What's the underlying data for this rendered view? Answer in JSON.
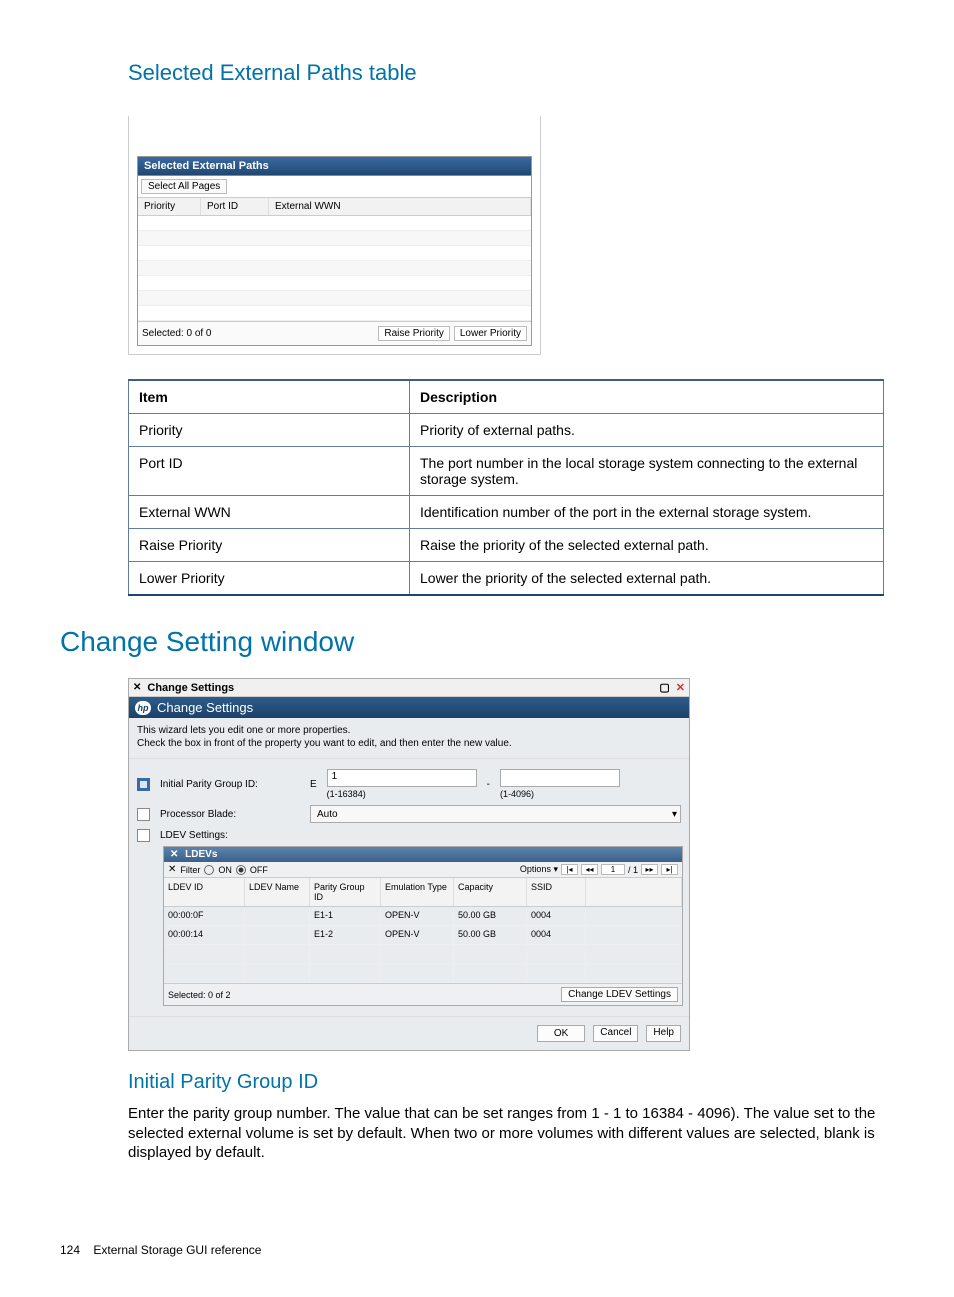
{
  "title1": "Selected External Paths table",
  "mock1": {
    "title": "Selected External Paths",
    "select_all": "Select All Pages",
    "headers": {
      "priority": "Priority",
      "port_id": "Port ID",
      "external_wwn": "External WWN"
    },
    "selected": "Selected: 0    of  0",
    "raise": "Raise Priority",
    "lower": "Lower Priority"
  },
  "desc_table": {
    "head": {
      "item": "Item",
      "description": "Description"
    },
    "rows": [
      {
        "item": "Priority",
        "description": "Priority of external paths."
      },
      {
        "item": "Port ID",
        "description": "The port number in the local storage system connecting to the external storage system."
      },
      {
        "item": "External WWN",
        "description": "Identification number of the port in the external storage system."
      },
      {
        "item": "Raise Priority",
        "description": "Raise the priority of the selected external path."
      },
      {
        "item": "Lower Priority",
        "description": "Lower the priority of the selected external path."
      }
    ]
  },
  "title2": "Change Setting window",
  "mock2": {
    "bar_title": "Change Settings",
    "panel_title": "Change Settings",
    "desc1": "This wizard lets you edit one or more properties.",
    "desc2": "Check the  box in front of the property you want to edit, and then enter the new value.",
    "ipg_label": "Initial Parity Group ID:",
    "ipg_prefix": "E",
    "ipg_v1": "1",
    "ipg_range1": "(1-16384)",
    "ipg_dash": "-",
    "ipg_range2": "(1-4096)",
    "pb_label": "Processor Blade:",
    "pb_value": "Auto",
    "ldev_label": "LDEV Settings:",
    "sec_title": "LDEVs",
    "filter_label": "Filter",
    "on": "ON",
    "off": "OFF",
    "options": "Options",
    "page_cur": "1",
    "page_total": "/ 1",
    "thead": {
      "c1": "LDEV ID",
      "c2": "LDEV Name",
      "c3": "Parity Group ID",
      "c4": "Emulation Type",
      "c5": "Capacity",
      "c6": "SSID"
    },
    "rows": [
      {
        "c1": "00:00:0F",
        "c2": "",
        "c3": "E1-1",
        "c4": "OPEN-V",
        "c5": "50.00 GB",
        "c6": "0004"
      },
      {
        "c1": "00:00:14",
        "c2": "",
        "c3": "E1-2",
        "c4": "OPEN-V",
        "c5": "50.00 GB",
        "c6": "0004"
      }
    ],
    "sec_selected": "Selected:  0     of  2",
    "change_btn": "Change LDEV Settings",
    "ok": "OK",
    "cancel": "Cancel",
    "help": "Help"
  },
  "title3": "Initial Parity Group ID",
  "para3": "Enter the parity group number. The value that can be set ranges from 1 - 1 to 16384 - 4096). The value set to the selected external volume is set by default. When two or more volumes with different values are selected, blank is displayed by default.",
  "footer_page": "124",
  "footer_text": "External Storage GUI reference"
}
